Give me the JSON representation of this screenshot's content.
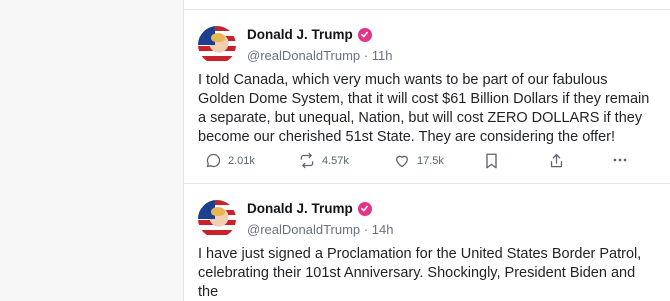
{
  "posts": [
    {
      "author": {
        "name": "Donald J. Trump",
        "handle": "@realDonaldTrump",
        "time": "11h"
      },
      "text": "I told Canada, which very much wants to be part of our fabulous Golden Dome System, that it will cost $61 Billion Dollars if they remain a separate, but unequal, Nation, but will cost ZERO DOLLARS if they become our cherished 51st State. They are considering the offer!",
      "stats": {
        "replies": "2.01k",
        "retruths": "4.57k",
        "likes": "17.5k"
      },
      "icons": [
        "reply-icon",
        "retruth-icon",
        "like-icon",
        "bookmark-icon",
        "share-icon",
        "more-icon"
      ]
    },
    {
      "author": {
        "name": "Donald J. Trump",
        "handle": "@realDonaldTrump",
        "time": "14h"
      },
      "text": "I have just signed a Proclamation for the United States Border Patrol, celebrating their 101st Anniversary. Shockingly, President Biden and the"
    }
  ],
  "colors": {
    "verified": "#e0358a",
    "muted": "#6b7280",
    "border": "#e3e5e8"
  }
}
